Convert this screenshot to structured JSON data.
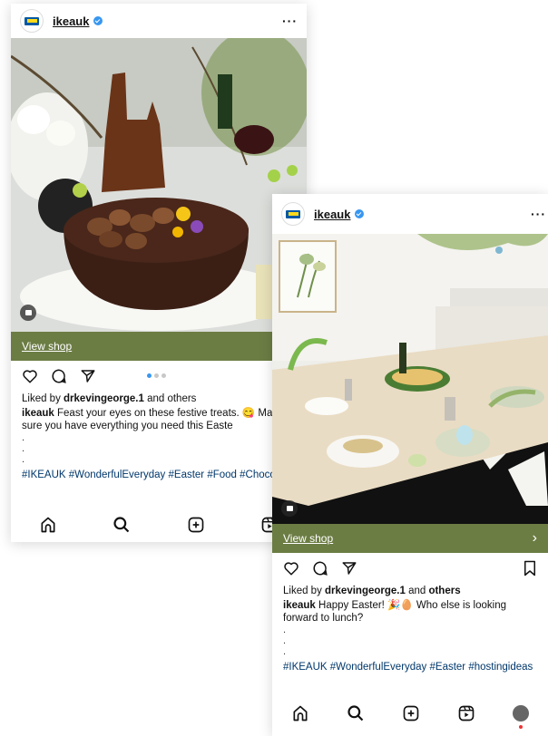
{
  "posts": [
    {
      "username": "ikeauk",
      "shop_label": "View shop",
      "liked_prefix": "Liked by ",
      "liked_user": "drkevingeorge.1",
      "liked_suffix": " and others",
      "caption_user": "ikeauk",
      "caption_text": " Feast your eyes on these festive treats. 😋 Make sure you have everything you need this Easte",
      "hashtags": "#IKEAUK #WonderfulEveryday #Easter #Food #Chocolate"
    },
    {
      "username": "ikeauk",
      "shop_label": "View shop",
      "liked_prefix": "Liked by ",
      "liked_user": "drkevingeorge.1",
      "liked_suffix": " and ",
      "liked_others": "others",
      "caption_user": "ikeauk",
      "caption_text": " Happy Easter! 🎉🥚 Who else is looking forward to lunch?",
      "hashtags": "#IKEAUK #WonderfulEveryday #Easter #hostingideas"
    }
  ],
  "more_glyph": "···",
  "dot_glyph": ".",
  "chevron_glyph": "›",
  "colors": {
    "shop_bar": "#6c7d44",
    "verified": "#3897f0",
    "hashtag": "#00376b"
  }
}
